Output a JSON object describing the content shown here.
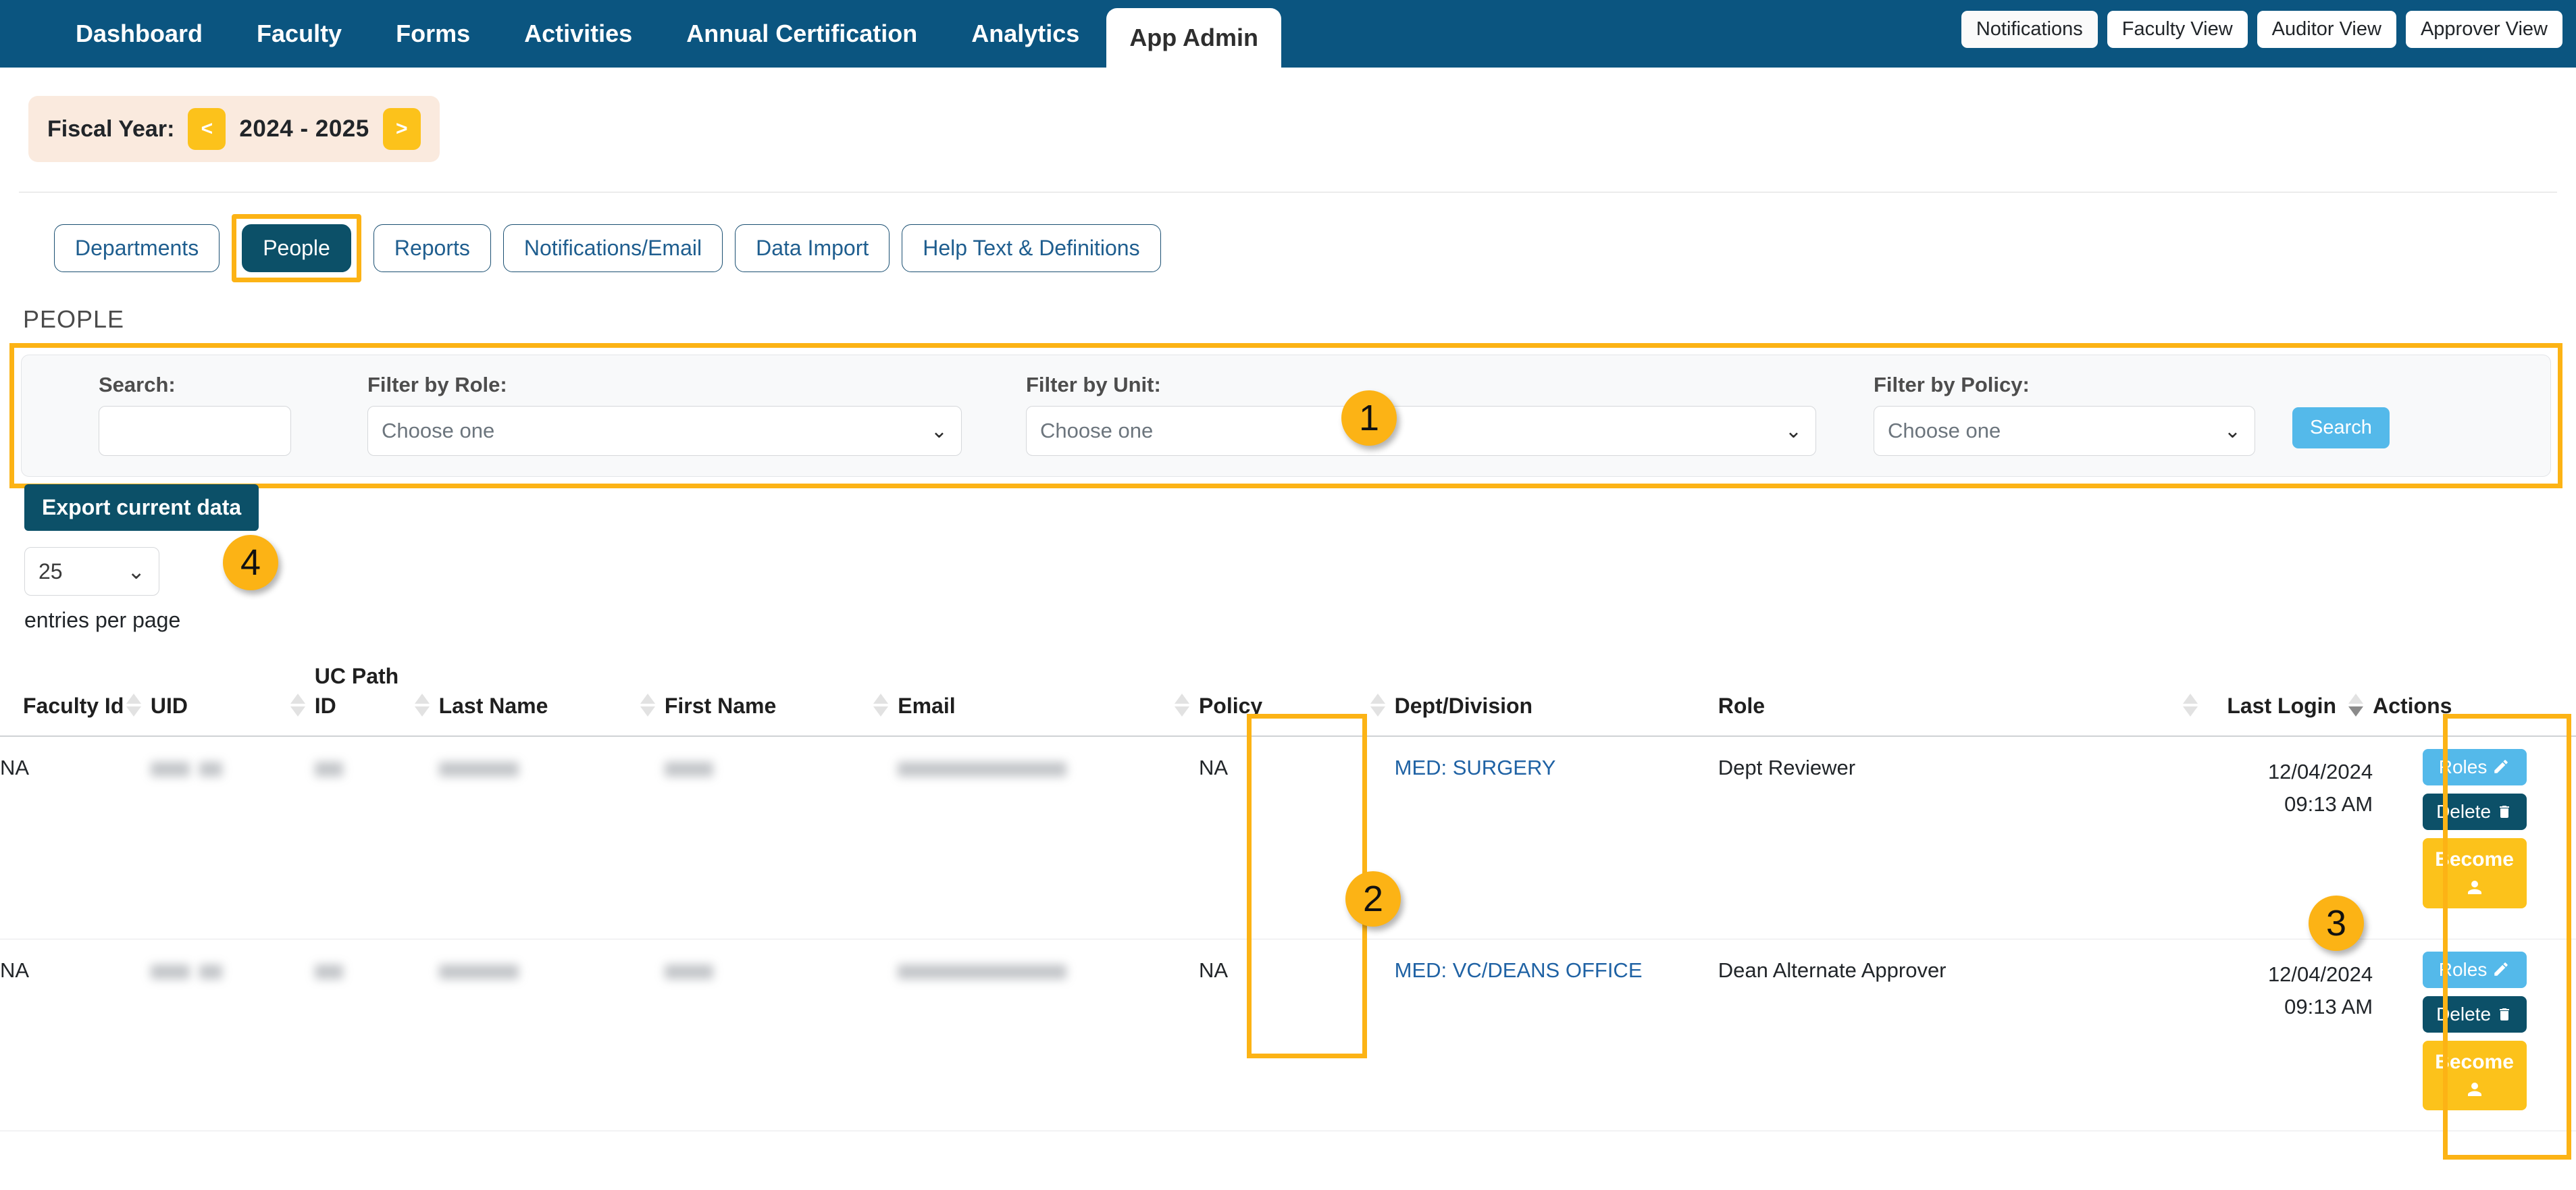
{
  "topnav": {
    "items": [
      {
        "label": "Dashboard",
        "active": false
      },
      {
        "label": "Faculty",
        "active": false
      },
      {
        "label": "Forms",
        "active": false
      },
      {
        "label": "Activities",
        "active": false
      },
      {
        "label": "Annual Certification",
        "active": false
      },
      {
        "label": "Analytics",
        "active": false
      },
      {
        "label": "App Admin",
        "active": true
      }
    ],
    "right_buttons": [
      "Notifications",
      "Faculty View",
      "Auditor View",
      "Approver View"
    ]
  },
  "fiscal_year": {
    "label": "Fiscal Year:",
    "prev": "<",
    "next": ">",
    "value": "2024 - 2025"
  },
  "subtabs": [
    {
      "label": "Departments",
      "active": false,
      "highlighted": false
    },
    {
      "label": "People",
      "active": true,
      "highlighted": true
    },
    {
      "label": "Reports",
      "active": false,
      "highlighted": false
    },
    {
      "label": "Notifications/Email",
      "active": false,
      "highlighted": false
    },
    {
      "label": "Data Import",
      "active": false,
      "highlighted": false
    },
    {
      "label": "Help Text & Definitions",
      "active": false,
      "highlighted": false
    }
  ],
  "page_title": "PEOPLE",
  "filters": {
    "search_label": "Search:",
    "search_value": "",
    "search_placeholder": "",
    "role_label": "Filter by Role:",
    "role_value": "Choose one",
    "unit_label": "Filter by Unit:",
    "unit_value": "Choose one",
    "policy_label": "Filter by Policy:",
    "policy_value": "Choose one",
    "search_button": "Search"
  },
  "toolbar": {
    "export_label": "Export current data",
    "entries_value": "25",
    "entries_label": "entries per page"
  },
  "table": {
    "headers": [
      {
        "label": "Faculty Id",
        "sortable": true,
        "sorted": "none"
      },
      {
        "label": "UID",
        "sortable": true,
        "sorted": "none"
      },
      {
        "label": "UC Path ID",
        "sortable": true,
        "sorted": "none"
      },
      {
        "label": "Last Name",
        "sortable": true,
        "sorted": "none"
      },
      {
        "label": "First Name",
        "sortable": true,
        "sorted": "none"
      },
      {
        "label": "Email",
        "sortable": true,
        "sorted": "none"
      },
      {
        "label": "Policy",
        "sortable": true,
        "sorted": "none"
      },
      {
        "label": "Dept/Division",
        "sortable": true,
        "sorted": "none"
      },
      {
        "label": "Role",
        "sortable": true,
        "sorted": "none"
      },
      {
        "label": "Last Login",
        "sortable": true,
        "sorted": "desc"
      },
      {
        "label": "Actions",
        "sortable": false,
        "sorted": "none"
      }
    ],
    "rows": [
      {
        "faculty_id": "NA",
        "uid": "",
        "ucpath_id": "",
        "last_name": "",
        "first_name": "",
        "email": "",
        "policy": "NA",
        "dept_division": "MED: SURGERY",
        "role": "Dept Reviewer",
        "last_login_date": "12/04/2024",
        "last_login_time": "09:13 AM",
        "actions": [
          "Roles",
          "Delete",
          "Become"
        ]
      },
      {
        "faculty_id": "NA",
        "uid": "",
        "ucpath_id": "",
        "last_name": "",
        "first_name": "",
        "email": "",
        "policy": "NA",
        "dept_division": "MED: VC/DEANS OFFICE",
        "role": "Dean Alternate Approver",
        "last_login_date": "12/04/2024",
        "last_login_time": "09:13 AM",
        "actions": [
          "Roles",
          "Delete",
          "Become"
        ]
      }
    ]
  },
  "callouts": [
    {
      "number": "1",
      "target": "filter-panel"
    },
    {
      "number": "2",
      "target": "dept-division-column"
    },
    {
      "number": "3",
      "target": "actions-column"
    },
    {
      "number": "4",
      "target": "export-current-data"
    }
  ],
  "colors": {
    "nav_blue": "#0b5580",
    "accent_amber": "#fcb315",
    "button_gold": "#fcc21b",
    "teal_dark": "#0c5068",
    "light_blue": "#54b9ea",
    "link_blue": "#1f62a4"
  }
}
